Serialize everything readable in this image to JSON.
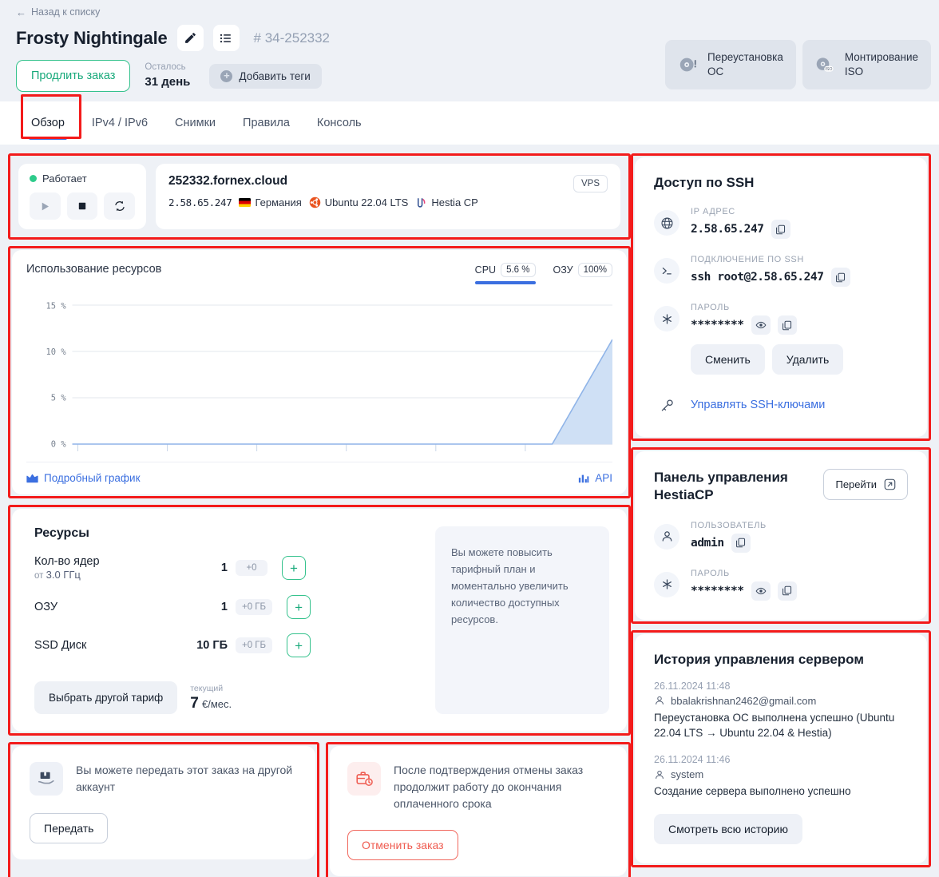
{
  "header": {
    "back_label": "Назад к списку",
    "title": "Frosty Nightingale",
    "order_number": "# 34-252332",
    "extend_label": "Продлить заказ",
    "remaining_label": "Осталось",
    "remaining_value": "31 день",
    "tags_label": "Добавить теги",
    "actions": [
      {
        "label_line1": "Переустановка",
        "label_line2": "ОС",
        "icon": "disc-alert-icon"
      },
      {
        "label_line1": "Монтирование",
        "label_line2": "ISO",
        "icon": "disc-iso-icon"
      }
    ]
  },
  "tabs": [
    {
      "label": "Обзор",
      "active": true
    },
    {
      "label": "IPv4 / IPv6",
      "active": false
    },
    {
      "label": "Снимки",
      "active": false
    },
    {
      "label": "Правила",
      "active": false
    },
    {
      "label": "Консоль",
      "active": false
    }
  ],
  "status": {
    "state_label": "Работает",
    "state_color": "#2ecb8b",
    "controls": [
      {
        "name": "start-button",
        "icon": "play-icon"
      },
      {
        "name": "stop-button",
        "icon": "stop-icon"
      },
      {
        "name": "reboot-button",
        "icon": "reboot-icon"
      }
    ]
  },
  "host": {
    "hostname": "252332.fornex.cloud",
    "ip": "2.58.65.247",
    "country": "Германия",
    "os": "Ubuntu 22.04 LTS",
    "panel": "Hestia CP",
    "badge": "VPS"
  },
  "chart_card": {
    "title": "Использование ресурсов",
    "metrics": [
      {
        "name": "CPU",
        "value": "5.6 %",
        "active": true
      },
      {
        "name": "ОЗУ",
        "value": "100%",
        "active": false
      }
    ],
    "detail_link": "Подробный график",
    "api_link": "API"
  },
  "chart_data": {
    "type": "area",
    "title": "Использование ресурсов",
    "series": [
      {
        "name": "CPU",
        "values": [
          0,
          0,
          0,
          0,
          0,
          0,
          0,
          0,
          0,
          0,
          0,
          0,
          0,
          0,
          0,
          0,
          0,
          0,
          0,
          0,
          0,
          0,
          0,
          0,
          0,
          0,
          0,
          0,
          0,
          0,
          0,
          0,
          0,
          0,
          0,
          0,
          0,
          0,
          0,
          0,
          0,
          0,
          0,
          0,
          0,
          0,
          0,
          0,
          0,
          0,
          0,
          0,
          0,
          0,
          0,
          0,
          0,
          0,
          0,
          0,
          0,
          0,
          0,
          0,
          0,
          0,
          0,
          0,
          0,
          0,
          0,
          0,
          0,
          0,
          0,
          0,
          0,
          0,
          0,
          0,
          0,
          0,
          0,
          0,
          0,
          0,
          0,
          0,
          0,
          0,
          1.4,
          2.8,
          4.2,
          5.6,
          7.0,
          8.4,
          9.8,
          11.3
        ]
      }
    ],
    "ylabel": "",
    "xlabel": "",
    "yticks": [
      "0 %",
      "5 %",
      "10 %",
      "15 %"
    ],
    "ytick_values": [
      0,
      5,
      10,
      15
    ],
    "ylim": [
      0,
      16.5
    ],
    "grid": true,
    "legend": "none",
    "line_color": "#8fb4e8",
    "fill_color": "#cfe0f5"
  },
  "resources": {
    "title": "Ресурсы",
    "rows": [
      {
        "label": "Кол-во ядер",
        "sublabel_prefix": "от",
        "sublabel": "3.0 ГГц",
        "amount": "1",
        "delta": "+0",
        "add": "+"
      },
      {
        "label": "ОЗУ",
        "sublabel_prefix": "",
        "sublabel": "",
        "amount": "1",
        "delta": "+0 ГБ",
        "add": "+"
      },
      {
        "label": "SSD Диск",
        "sublabel_prefix": "",
        "sublabel": "",
        "amount": "10 ГБ",
        "delta": "+0 ГБ",
        "add": "+"
      }
    ],
    "plan_button": "Выбрать другой тариф",
    "price_label": "текущий",
    "price_amount": "7",
    "price_currency": "€",
    "price_period": "/мес.",
    "note": "Вы можете повысить тарифный план и моментально увеличить количество доступных ресурсов."
  },
  "transfer_card": {
    "text": "Вы можете передать этот заказ на другой аккаунт",
    "button": "Передать",
    "icon": "package-handover-icon"
  },
  "cancel_card": {
    "text": "После подтверждения отмены заказ продолжит работу до окончания оплаченного срока",
    "button": "Отменить заказ",
    "icon": "briefcase-clock-icon",
    "accent": "#ef5b50"
  },
  "ssh": {
    "title": "Доступ по SSH",
    "ip_label": "IP АДРЕС",
    "ip_value": "2.58.65.247",
    "conn_label": "ПОДКЛЮЧЕНИЕ ПО SSH",
    "conn_value": "ssh root@2.58.65.247",
    "pass_label": "ПАРОЛЬ",
    "pass_value": "********",
    "change_button": "Сменить",
    "delete_button": "Удалить",
    "keys_link": "Управлять SSH-ключами"
  },
  "hestia": {
    "title": "Панель управления HestiaCP",
    "goto_button": "Перейти",
    "user_label": "ПОЛЬЗОВАТЕЛЬ",
    "user_value": "admin",
    "pass_label": "ПАРОЛЬ",
    "pass_value": "********"
  },
  "history": {
    "title": "История управления сервером",
    "entries": [
      {
        "date": "26.11.2024 11:48",
        "user": "bbalakrishnan2462@gmail.com",
        "text": "Переустановка ОС выполнена успешно (Ubuntu 22.04 LTS → Ubuntu 22.04 & Hestia)"
      },
      {
        "date": "26.11.2024 11:46",
        "user": "system",
        "text": "Создание сервера выполнено успешно"
      }
    ],
    "all_button": "Смотреть всю историю"
  }
}
